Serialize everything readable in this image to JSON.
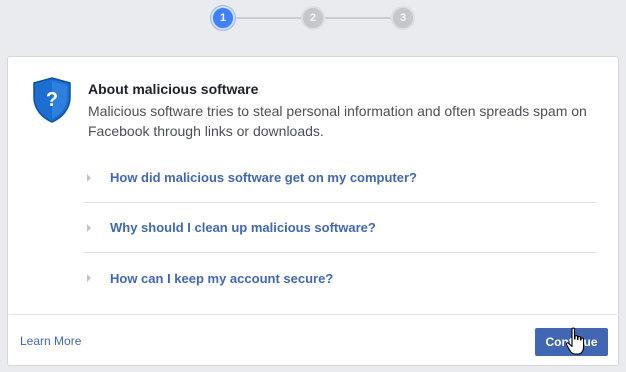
{
  "stepper": {
    "steps": [
      {
        "label": "1",
        "state": "active"
      },
      {
        "label": "2",
        "state": "inactive"
      },
      {
        "label": "3",
        "state": "inactive"
      }
    ]
  },
  "card": {
    "icon": "question-shield-icon",
    "title": "About malicious software",
    "description": "Malicious software tries to steal personal information and often spreads spam on Facebook through links or downloads.",
    "faqs": [
      "How did malicious software get on my computer?",
      "Why should I clean up malicious software?",
      "How can I keep my account secure?"
    ]
  },
  "footer": {
    "learn_more": "Learn More",
    "continue_label": "Continue"
  },
  "colors": {
    "accent": "#4267b2",
    "step_active": "#4080ff",
    "background": "#e9ebee"
  }
}
